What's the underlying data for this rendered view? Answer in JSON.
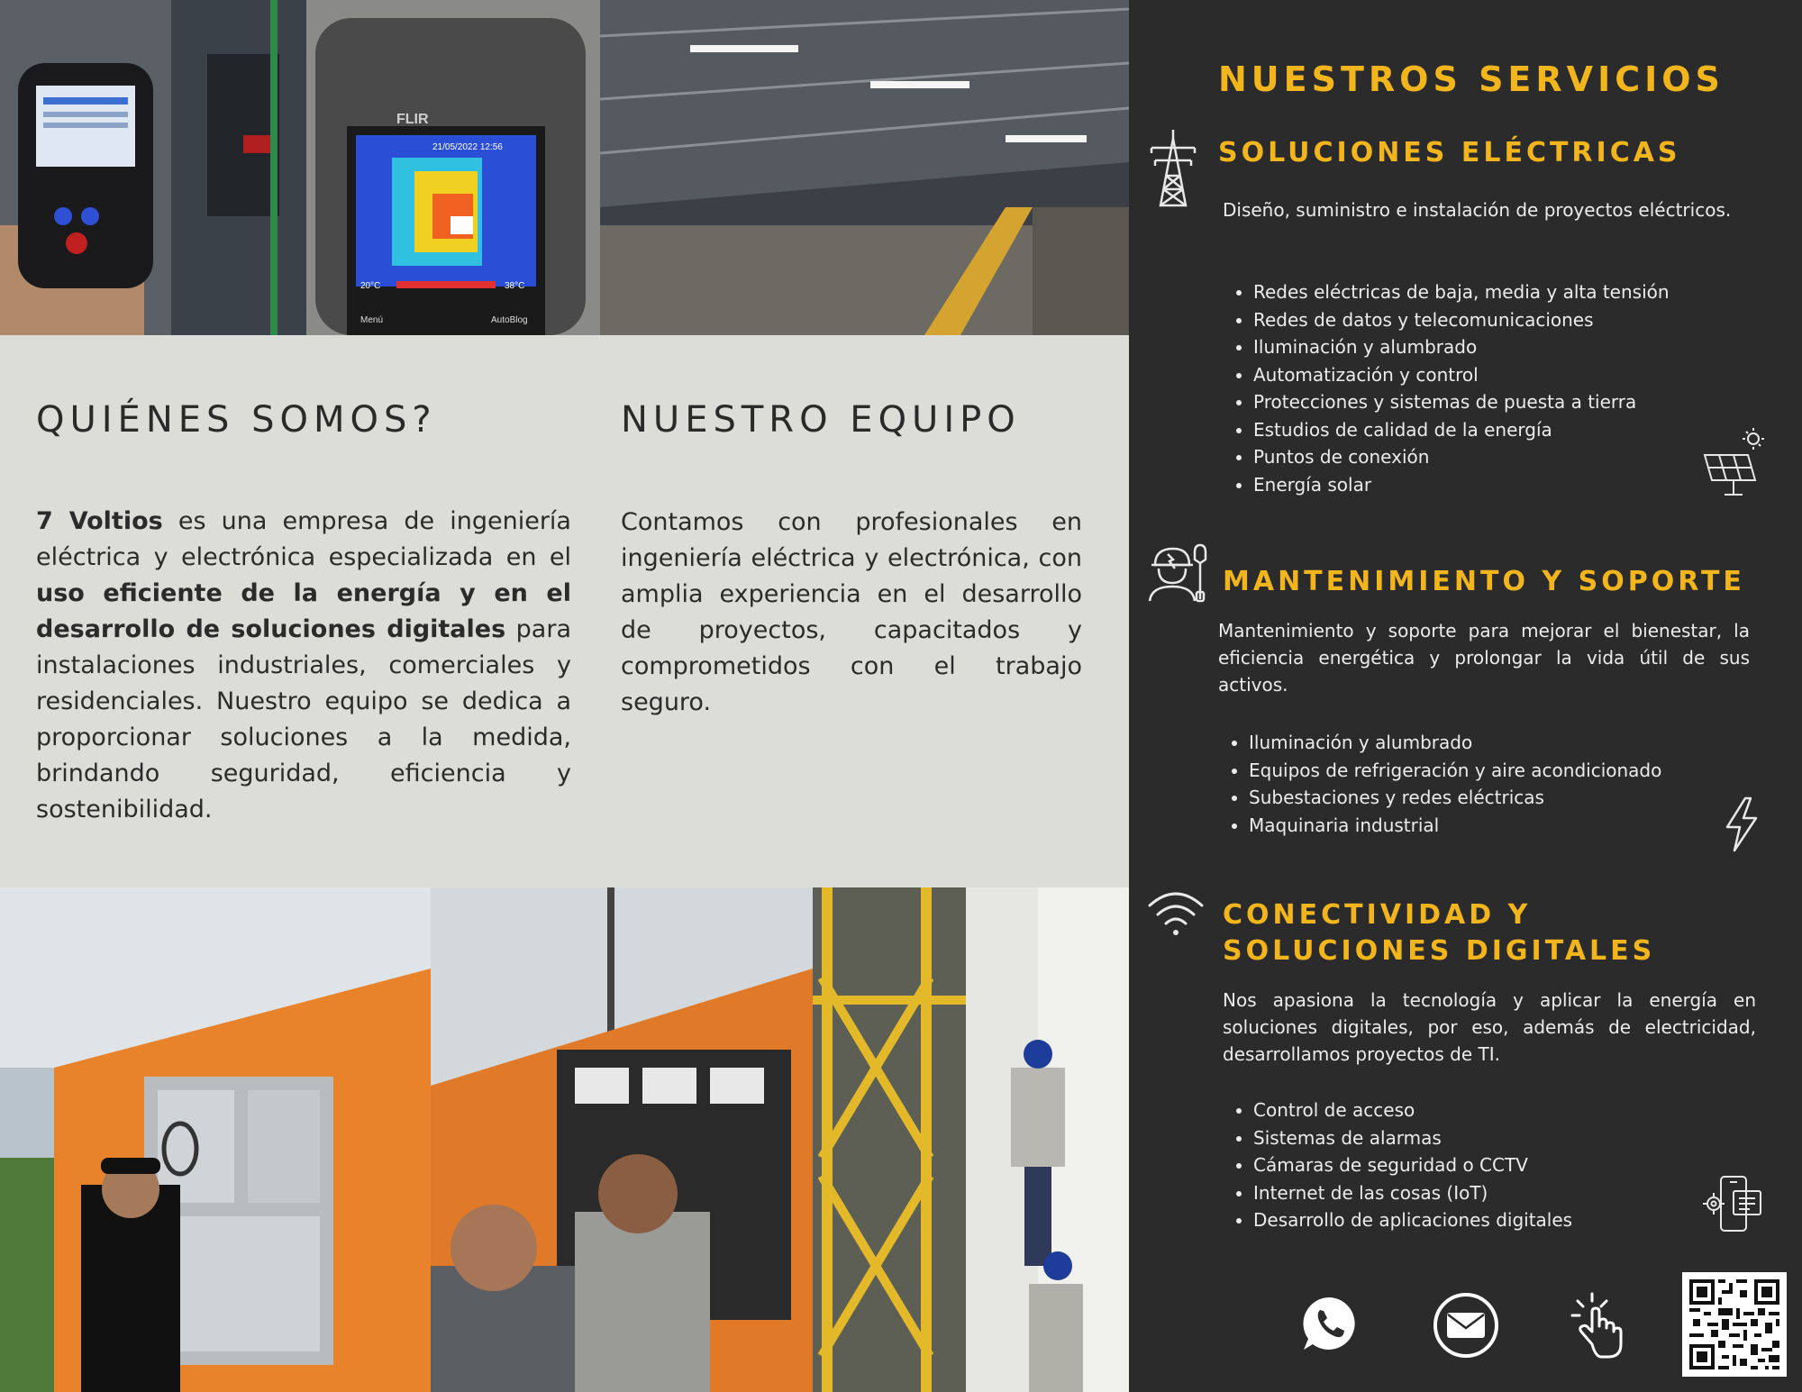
{
  "about": {
    "title": "QUIÉNES SOMOS?",
    "company_name": "7 Voltios",
    "text1": " es una empresa de ingeniería eléctrica y electrónica especializada en el ",
    "highlight": "uso eficiente de la energía y en el desarrollo de soluciones digitales",
    "text2": " para instalaciones industriales, comerciales y residenciales. Nuestro equipo se dedica a proporcionar soluciones a la medida, brindando seguridad, eficiencia y sostenibilidad."
  },
  "team": {
    "title": "NUESTRO EQUIPO",
    "text": "Contamos con profesionales en ingeniería eléctrica y electrónica, con amplia experiencia en el desarrollo de proyectos, capacitados y comprometidos con el trabajo seguro."
  },
  "services": {
    "title": "NUESTROS SERVICIOS",
    "sections": [
      {
        "title": "SOLUCIONES ELÉCTRICAS",
        "description": "Diseño, suministro e instalación de proyectos eléctricos.",
        "items": [
          "Redes eléctricas de baja, media y alta tensión",
          "Redes de datos y telecomunicaciones",
          "Iluminación y alumbrado",
          "Automatización y control",
          "Protecciones y sistemas de puesta a tierra",
          "Estudios de calidad de la energía",
          "Puntos de conexión",
          "Energía solar"
        ]
      },
      {
        "title": "MANTENIMIENTO Y SOPORTE",
        "description": "Mantenimiento y soporte para mejorar el bienestar, la eficiencia energética y prolongar la vida útil de sus activos.",
        "items": [
          "Iluminación y alumbrado",
          "Equipos de refrigeración y aire acondicionado",
          "Subestaciones y redes eléctricas",
          "Maquinaria industrial"
        ]
      },
      {
        "title": "CONECTIVIDAD Y SOLUCIONES DIGITALES",
        "description": "Nos apasiona la tecnología y aplicar la energía en soluciones digitales, por eso, además de electricidad, desarrollamos proyectos de TI.",
        "items": [
          "Control de acceso",
          "Sistemas de alarmas",
          "Cámaras de seguridad o CCTV",
          "Internet de las cosas (IoT)",
          "Desarrollo de aplicaciones digitales"
        ]
      }
    ]
  },
  "photos": {
    "thermal_brand": "FLIR",
    "thermal_date": "21/05/2022 12:56",
    "thermal_temp_low": "20°C",
    "thermal_temp_high": "38°C",
    "thermal_menu": "Menú",
    "thermal_autoblog": "AutoBlog"
  },
  "icons": {
    "tower": "power-tower-icon",
    "technician": "technician-wrench-icon",
    "wifi": "wifi-icon",
    "solar": "solar-panel-icon",
    "bolt": "lightning-icon",
    "devices": "devices-gear-icon",
    "whatsapp": "whatsapp-icon",
    "email": "email-icon",
    "click": "click-hand-icon",
    "qr": "qr-code-icon"
  },
  "colors": {
    "accent": "#f2b51c",
    "dark_panel": "#2b2b2b",
    "light_panel": "#dcdcd8"
  }
}
